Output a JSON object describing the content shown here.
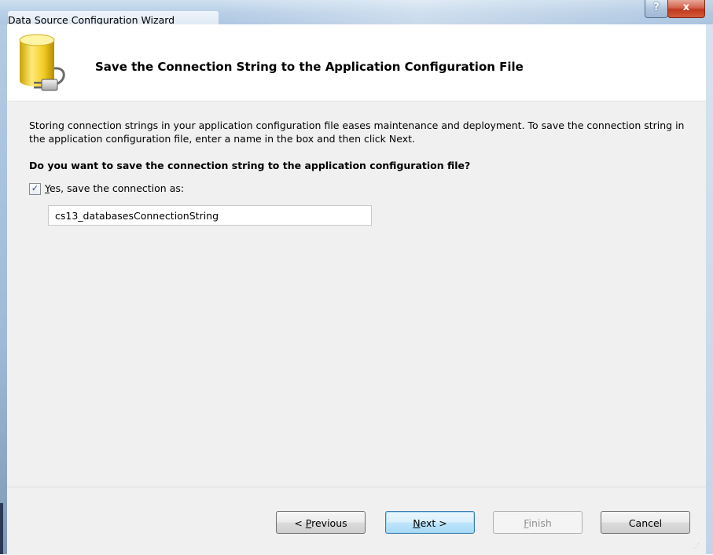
{
  "window": {
    "title": "Data Source Configuration Wizard",
    "help_symbol": "?",
    "close_symbol": "x"
  },
  "header": {
    "title": "Save the Connection String to the Application Configuration File",
    "icon": "database-connection-icon"
  },
  "body": {
    "description": "Storing connection strings in your application configuration file eases maintenance and deployment. To save the connection string in the application configuration file, enter a name in the box and then click Next.",
    "question": "Do you want to save the connection string to the application configuration file?",
    "checkbox": {
      "checked": true,
      "mnemonic": "Y",
      "rest": "es, save the connection as:"
    },
    "connection_name": "cs13_databasesConnectionString"
  },
  "buttons": {
    "previous": {
      "prefix": "< ",
      "mnemonic": "P",
      "rest": "revious"
    },
    "next": {
      "mnemonic": "N",
      "rest": "ext >"
    },
    "finish": {
      "mnemonic": "F",
      "rest": "inish",
      "enabled": false
    },
    "cancel": "Cancel"
  },
  "colors": {
    "titlebar": "#b7cee6",
    "close_button": "#c0391f",
    "dialog_bg": "#f0f0f0",
    "default_button_border": "#3c7fb1"
  }
}
